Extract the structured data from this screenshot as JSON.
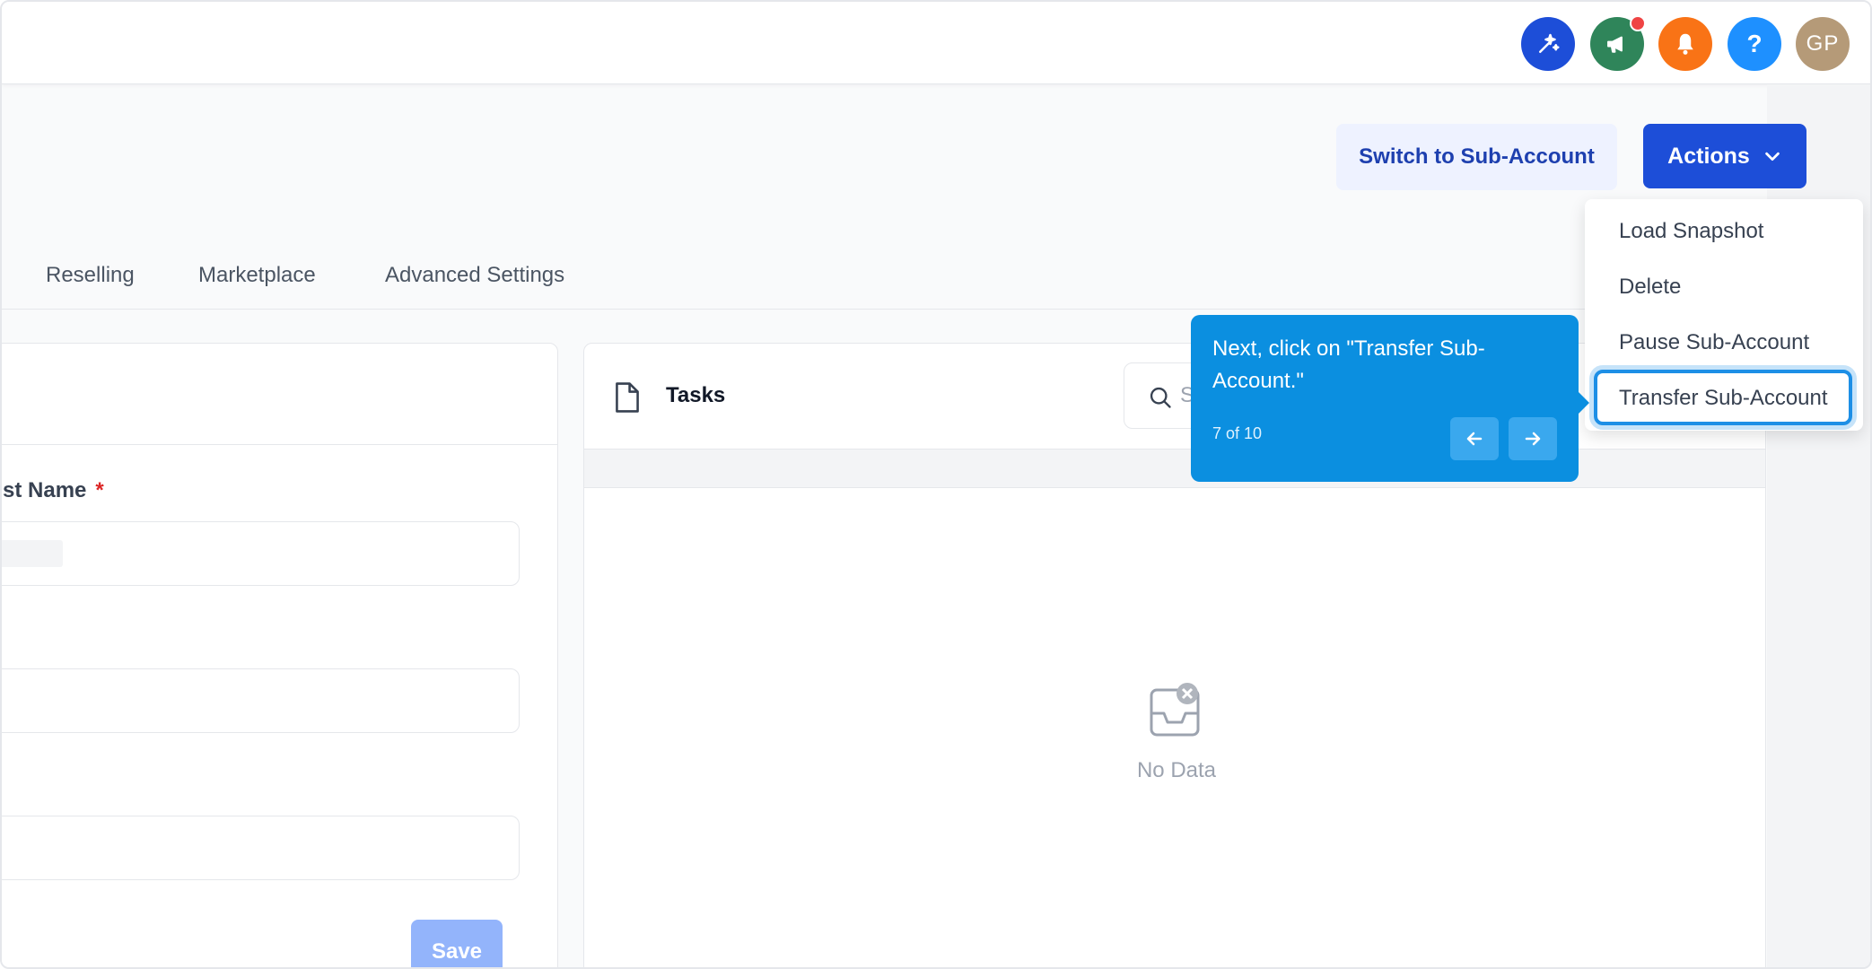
{
  "topbar": {
    "icons": [
      {
        "name": "magic-sparkle-icon",
        "color": "#1d4ed8"
      },
      {
        "name": "megaphone-icon",
        "color": "#2f855a"
      },
      {
        "name": "bell-icon",
        "color": "#f97316"
      },
      {
        "name": "help-icon",
        "color": "#1e90ff",
        "label": "?"
      },
      {
        "name": "avatar",
        "color": "#b59a78",
        "label": "GP"
      }
    ]
  },
  "header": {
    "switch_label": "Switch to Sub-Account",
    "actions_label": "Actions"
  },
  "tabs": [
    "Reselling",
    "Marketplace",
    "Advanced Settings"
  ],
  "form": {
    "field_label": "st Name",
    "required_mark": "*",
    "save_label": "Save"
  },
  "tasks": {
    "title": "Tasks",
    "search_placeholder": "S",
    "empty_text": "No Data"
  },
  "menu": {
    "items": [
      "Load Snapshot",
      "Delete",
      "Pause Sub-Account",
      "Transfer Sub-Account"
    ]
  },
  "tooltip": {
    "message": "Next, click on \"Transfer Sub-Account.\"",
    "step": "7 of 10"
  },
  "colors": {
    "primary": "#1d4ed8",
    "tooltip": "#0b8fe0",
    "highlight": "#1d8fe6",
    "required": "#dc2626"
  }
}
